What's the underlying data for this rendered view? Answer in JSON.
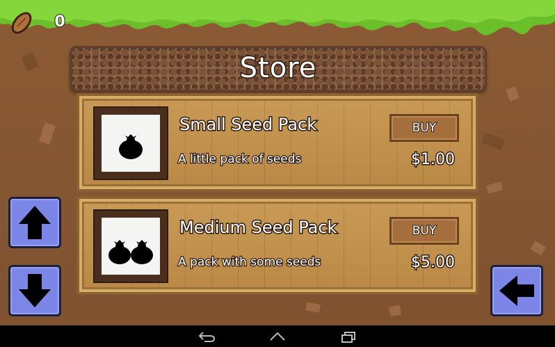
{
  "hud": {
    "seed_icon": "almond-seed-icon",
    "seed_count": "0"
  },
  "store": {
    "title": "Store",
    "items": [
      {
        "name": "Small Seed Pack",
        "description": "A little pack of seeds",
        "buy_label": "BUY",
        "price": "$1.00",
        "icon": "seed-bag-icon"
      },
      {
        "name": "Medium Seed Pack",
        "description": "A pack with some seeds",
        "buy_label": "BUY",
        "price": "$5.00",
        "icon": "two-seed-bags-icon"
      }
    ]
  },
  "controls": {
    "scroll_up": "arrow-up-icon",
    "scroll_down": "arrow-down-icon",
    "back": "arrow-left-icon"
  },
  "system_bar": {
    "back": "system-back-icon",
    "home": "system-home-icon",
    "recents": "system-recents-icon"
  },
  "colors": {
    "dirt": "#8a5a34",
    "grass": "#6bbf2a",
    "wood": "#c99a55",
    "button_blue": "#7b86e6"
  }
}
